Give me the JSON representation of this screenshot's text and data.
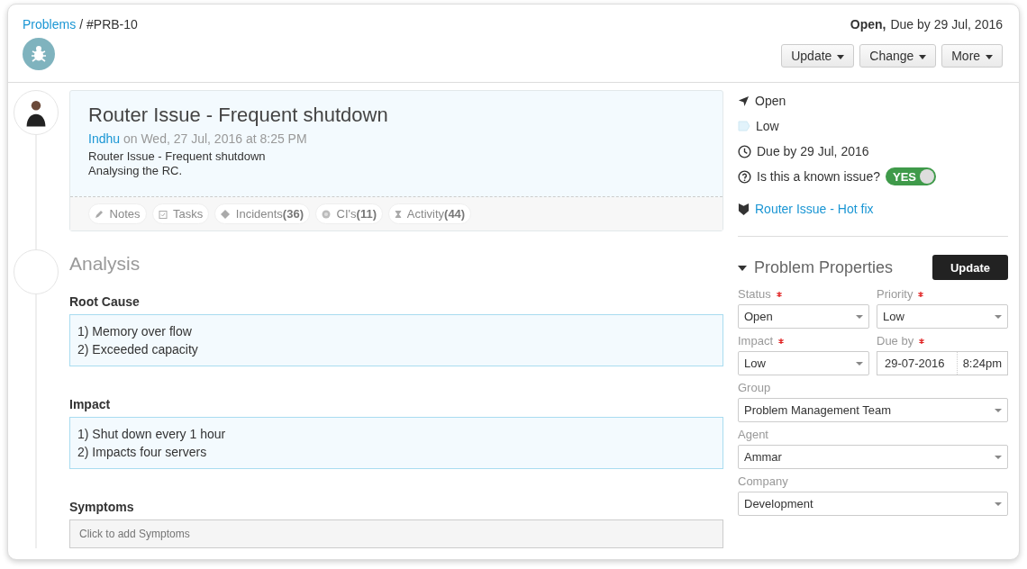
{
  "breadcrumb": {
    "link": "Problems",
    "separator": "/",
    "id": "#PRB-10"
  },
  "status_summary": {
    "status": "Open,",
    "due": "Due by 29 Jul, 2016"
  },
  "header_buttons": [
    "Update",
    "Change",
    "More"
  ],
  "note": {
    "title": "Router Issue - Frequent shutdown",
    "author": "Indhu",
    "meta": "on Wed, 27 Jul, 2016 at 8:25 PM",
    "body": [
      "Router Issue - Frequent shutdown",
      "Analysing the RC."
    ],
    "tabs": [
      {
        "kind": "notes",
        "label": "Notes"
      },
      {
        "kind": "tasks",
        "label": "Tasks"
      },
      {
        "kind": "incidents",
        "label": "Incidents",
        "count": "(36)"
      },
      {
        "kind": "cis",
        "label": "CI's",
        "count": "(11)"
      },
      {
        "kind": "activity",
        "label": "Activity",
        "count": "(44)"
      }
    ]
  },
  "analysis": {
    "heading": "Analysis",
    "sections": [
      {
        "label": "Root Cause",
        "lines": [
          "1) Memory over flow",
          "2) Exceeded capacity"
        ]
      },
      {
        "label": "Impact",
        "lines": [
          "1) Shut down every 1 hour",
          "2) Impacts four servers"
        ]
      },
      {
        "label": "Symptoms",
        "placeholder": "Click to add Symptoms"
      }
    ]
  },
  "summary": {
    "status": "Open",
    "priority": "Low",
    "due": "Due by 29 Jul, 2016",
    "known_issue": {
      "label": "Is this a known issue?",
      "on": true,
      "value": "YES"
    },
    "solution_link": "Router Issue - Hot fix"
  },
  "properties": {
    "title": "Problem Properties",
    "expanded": true,
    "update_button": "Update",
    "row_fields": [
      {
        "label": "Status",
        "value": "Open"
      },
      {
        "label": "Priority",
        "value": "Low"
      },
      {
        "label": "Impact",
        "value": "Low"
      }
    ],
    "due_by": {
      "label": "Due by",
      "date": "29-07-2016",
      "time": "8:24pm"
    },
    "wide_fields": [
      {
        "label": "Group",
        "value": "Problem Management Team"
      },
      {
        "label": "Agent",
        "value": "Ammar"
      },
      {
        "label": "Company",
        "value": "Development"
      }
    ]
  }
}
